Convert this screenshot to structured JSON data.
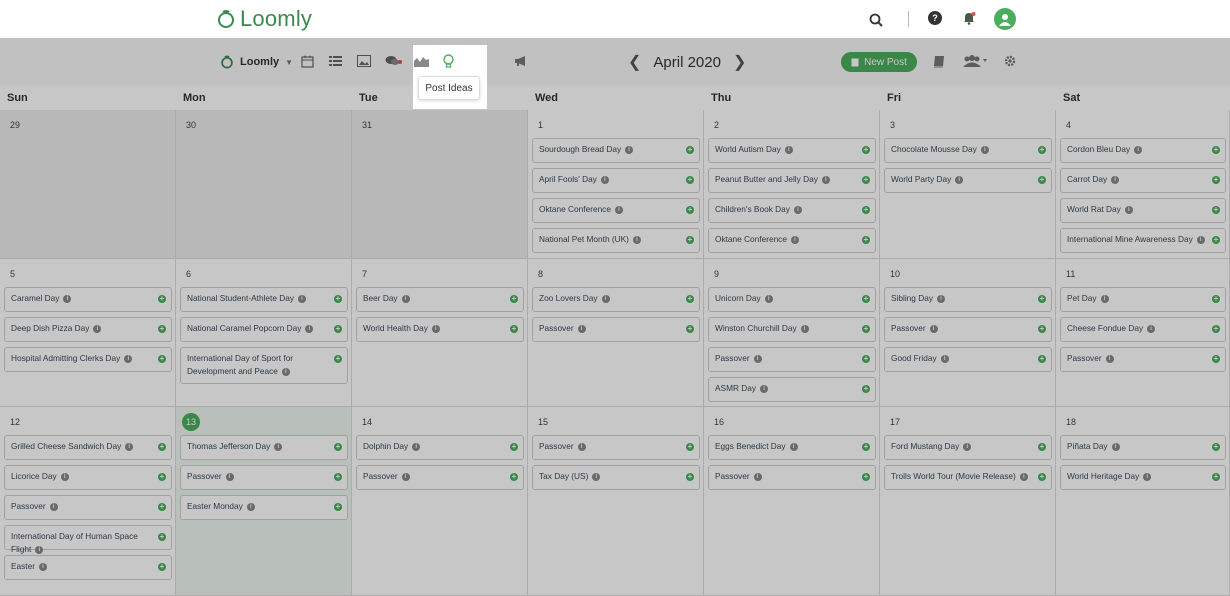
{
  "app": {
    "logo_text": "Loomly"
  },
  "toolbar": {
    "brand_name": "Loomly",
    "month_label": "April 2020",
    "new_post_label": "New Post",
    "tooltip": "Post Ideas"
  },
  "days": [
    "Sun",
    "Mon",
    "Tue",
    "Wed",
    "Thu",
    "Fri",
    "Sat"
  ],
  "weeks": [
    [
      {
        "n": "29",
        "past": true,
        "events": []
      },
      {
        "n": "30",
        "past": true,
        "events": []
      },
      {
        "n": "31",
        "past": true,
        "events": []
      },
      {
        "n": "1",
        "events": [
          "Sourdough Bread Day",
          "April Fools' Day",
          "Oktane Conference",
          "National Pet Month (UK)"
        ]
      },
      {
        "n": "2",
        "events": [
          "World Autism Day",
          "Peanut Butter and Jelly Day",
          "Children's Book Day",
          "Oktane Conference"
        ]
      },
      {
        "n": "3",
        "events": [
          "Chocolate Mousse Day",
          "World Party Day"
        ]
      },
      {
        "n": "4",
        "events": [
          "Cordon Bleu Day",
          "Carrot Day",
          "World Rat Day",
          "International Mine Awareness Day"
        ]
      }
    ],
    [
      {
        "n": "5",
        "events": [
          "Caramel Day",
          "Deep Dish Pizza Day",
          "Hospital Admitting Clerks Day"
        ]
      },
      {
        "n": "6",
        "events": [
          "National Student-Athlete Day",
          "National Caramel Popcorn Day",
          "International Day of Sport for Development and Peace"
        ]
      },
      {
        "n": "7",
        "events": [
          "Beer Day",
          "World Health Day"
        ]
      },
      {
        "n": "8",
        "events": [
          "Zoo Lovers Day",
          "Passover"
        ]
      },
      {
        "n": "9",
        "events": [
          "Unicorn Day",
          "Winston Churchill Day",
          "Passover",
          "ASMR Day"
        ]
      },
      {
        "n": "10",
        "events": [
          "Sibling Day",
          "Passover",
          "Good Friday"
        ]
      },
      {
        "n": "11",
        "events": [
          "Pet Day",
          "Cheese Fondue Day",
          "Passover"
        ]
      }
    ],
    [
      {
        "n": "12",
        "events": [
          "Grilled Cheese Sandwich Day",
          "Licorice Day",
          "Passover",
          "International Day of Human Space Flight",
          "Easter"
        ]
      },
      {
        "n": "13",
        "today": true,
        "events": [
          "Thomas Jefferson Day",
          "Passover",
          "Easter Monday"
        ]
      },
      {
        "n": "14",
        "events": [
          "Dolphin Day",
          "Passover"
        ]
      },
      {
        "n": "15",
        "events": [
          "Passover",
          "Tax Day (US)"
        ]
      },
      {
        "n": "16",
        "events": [
          "Eggs Benedict Day",
          "Passover"
        ]
      },
      {
        "n": "17",
        "events": [
          "Ford Mustang Day",
          "Trolls World Tour (Movie Release)"
        ]
      },
      {
        "n": "18",
        "events": [
          "Piñata Day",
          "World Heritage Day"
        ]
      }
    ]
  ]
}
